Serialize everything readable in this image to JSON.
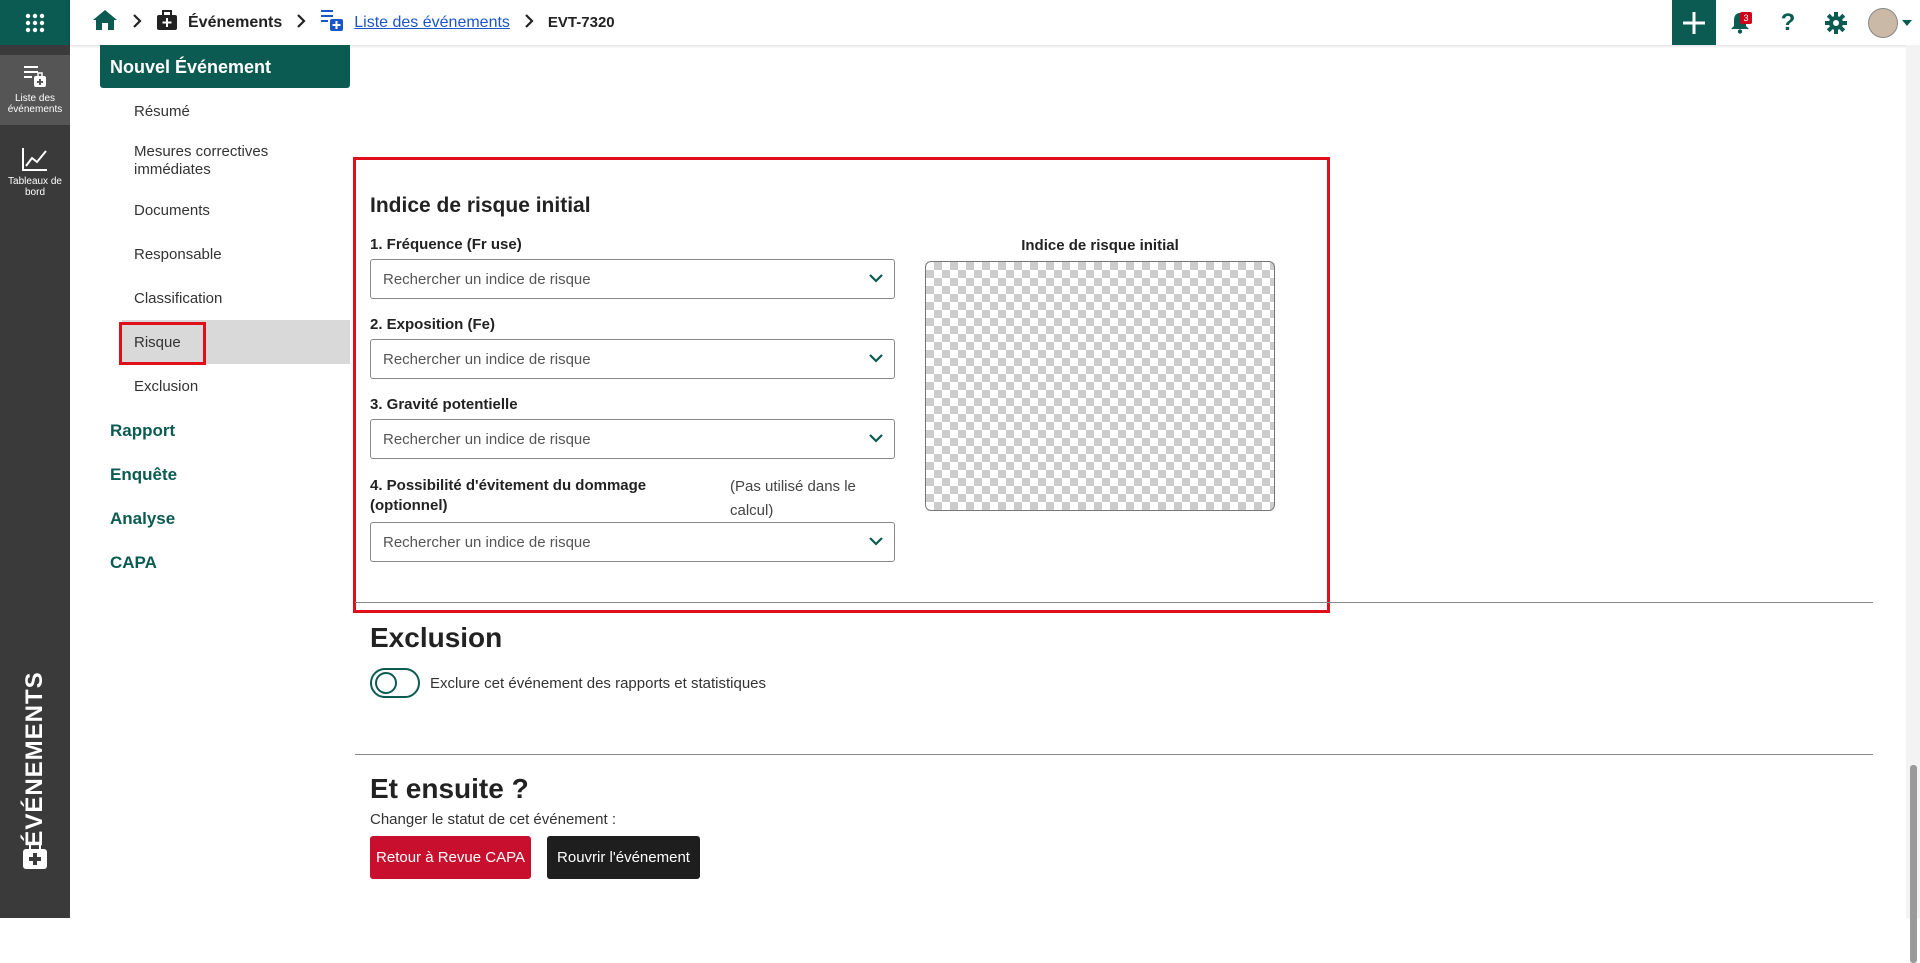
{
  "topbar": {
    "breadcrumb_events": "Événements",
    "breadcrumb_list": "Liste des événements",
    "breadcrumb_id": "EVT-7320",
    "notification_count": "3"
  },
  "rail": {
    "list_label": "Liste des événements",
    "dashboards_label": "Tableaux de bord",
    "module_label": "ÉVÉNEMENTS"
  },
  "nav": {
    "header": "Nouvel Événement",
    "items": [
      "Résumé",
      "Mesures correctives immédiates",
      "Documents",
      "Responsable",
      "Classification",
      "Risque",
      "Exclusion"
    ],
    "sections": [
      "Rapport",
      "Enquête",
      "Analyse",
      "CAPA"
    ]
  },
  "risk": {
    "title": "Indice de risque initial",
    "chart_title": "Indice de risque initial",
    "fields": [
      {
        "label": "1. Fréquence (Fr use)",
        "placeholder": "Rechercher un indice de risque"
      },
      {
        "label": "2. Exposition (Fe)",
        "placeholder": "Rechercher un indice de risque"
      },
      {
        "label": "3. Gravité potentielle",
        "placeholder": "Rechercher un indice de risque"
      },
      {
        "label": "4. Possibilité d'évitement du dommage (optionnel)",
        "placeholder": "Rechercher un indice de risque",
        "note": "(Pas utilisé dans le calcul)"
      }
    ]
  },
  "exclusion": {
    "title": "Exclusion",
    "toggle_label": "Exclure cet événement des rapports et statistiques"
  },
  "next": {
    "title": "Et ensuite ?",
    "status_text": "Changer le statut de cet événement :",
    "btn_back": "Retour à Revue CAPA",
    "btn_reopen": "Rouvrir l'événement"
  },
  "colors": {
    "brand": "#0b5b52",
    "highlight": "#e0101a",
    "danger_button": "#c8102e"
  }
}
